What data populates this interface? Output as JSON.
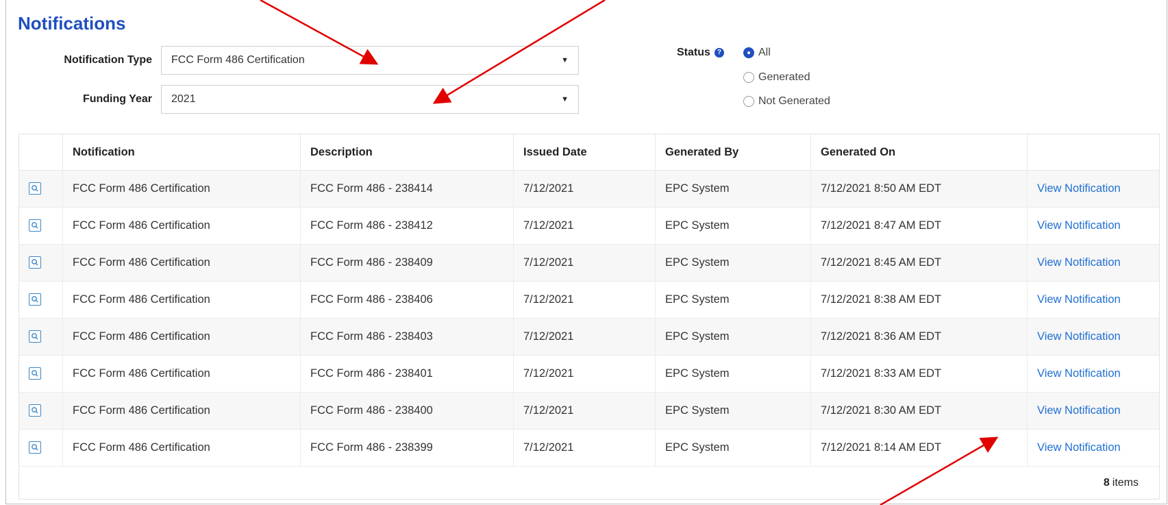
{
  "page": {
    "title": "Notifications"
  },
  "filters": {
    "notification_type_label": "Notification Type",
    "notification_type_value": "FCC Form 486 Certification",
    "funding_year_label": "Funding Year",
    "funding_year_value": "2021",
    "status_label": "Status",
    "status_options": [
      {
        "label": "All",
        "checked": true
      },
      {
        "label": "Generated",
        "checked": false
      },
      {
        "label": "Not Generated",
        "checked": false
      }
    ]
  },
  "table": {
    "columns": [
      "",
      "Notification",
      "Description",
      "Issued Date",
      "Generated By",
      "Generated On",
      ""
    ],
    "rows": [
      {
        "notification": "FCC Form 486 Certification",
        "description": "FCC Form 486 - 238414",
        "issued": "7/12/2021",
        "by": "EPC System",
        "on": "7/12/2021 8:50 AM EDT",
        "action": "View Notification"
      },
      {
        "notification": "FCC Form 486 Certification",
        "description": "FCC Form 486 - 238412",
        "issued": "7/12/2021",
        "by": "EPC System",
        "on": "7/12/2021 8:47 AM EDT",
        "action": "View Notification"
      },
      {
        "notification": "FCC Form 486 Certification",
        "description": "FCC Form 486 - 238409",
        "issued": "7/12/2021",
        "by": "EPC System",
        "on": "7/12/2021 8:45 AM EDT",
        "action": "View Notification"
      },
      {
        "notification": "FCC Form 486 Certification",
        "description": "FCC Form 486 - 238406",
        "issued": "7/12/2021",
        "by": "EPC System",
        "on": "7/12/2021 8:38 AM EDT",
        "action": "View Notification"
      },
      {
        "notification": "FCC Form 486 Certification",
        "description": "FCC Form 486 - 238403",
        "issued": "7/12/2021",
        "by": "EPC System",
        "on": "7/12/2021 8:36 AM EDT",
        "action": "View Notification"
      },
      {
        "notification": "FCC Form 486 Certification",
        "description": "FCC Form 486 - 238401",
        "issued": "7/12/2021",
        "by": "EPC System",
        "on": "7/12/2021 8:33 AM EDT",
        "action": "View Notification"
      },
      {
        "notification": "FCC Form 486 Certification",
        "description": "FCC Form 486 - 238400",
        "issued": "7/12/2021",
        "by": "EPC System",
        "on": "7/12/2021 8:30 AM EDT",
        "action": "View Notification"
      },
      {
        "notification": "FCC Form 486 Certification",
        "description": "FCC Form 486 - 238399",
        "issued": "7/12/2021",
        "by": "EPC System",
        "on": "7/12/2021 8:14 AM EDT",
        "action": "View Notification"
      }
    ],
    "footer_count": "8",
    "footer_suffix": "items"
  },
  "colors": {
    "brand_blue": "#1f4fbf",
    "link_blue": "#1f6fd1",
    "annotation_red": "#e00000"
  },
  "icons": {
    "row_action": "search-icon",
    "help": "question-circle-icon",
    "dropdown": "caret-down-icon"
  }
}
